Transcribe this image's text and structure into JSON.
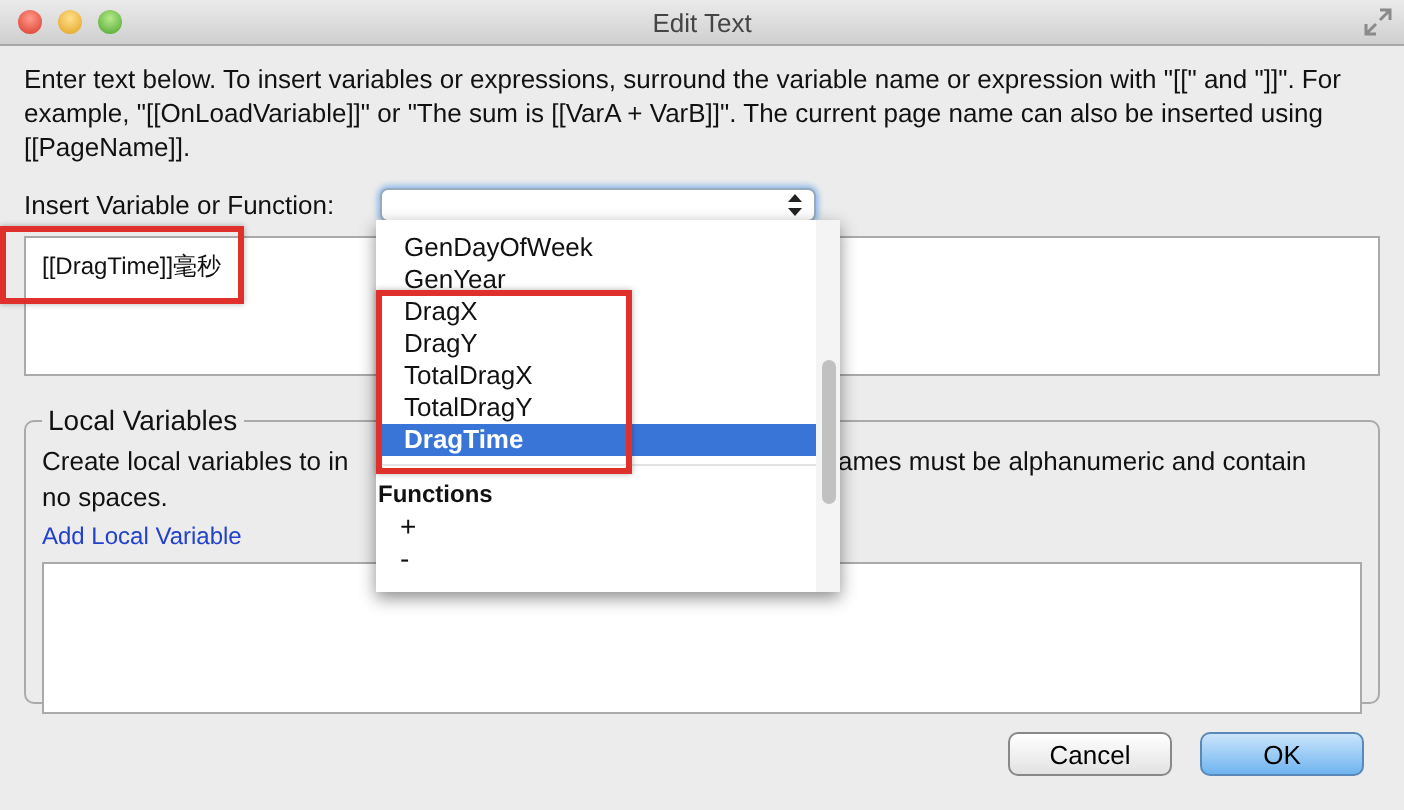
{
  "window": {
    "title": "Edit Text"
  },
  "instructions": "Enter text below. To insert variables or expressions, surround the variable name or expression with \"[[\" and \"]]\". For example, \"[[OnLoadVariable]]\" or \"The sum is [[VarA + VarB]]\". The current page name can also be inserted using [[PageName]].",
  "insert_label": "Insert Variable or Function:",
  "insert_select": {
    "expanded": true
  },
  "text_area": {
    "value": "[[DragTime]]毫秒"
  },
  "dropdown": {
    "items": [
      {
        "kind": "item",
        "label": "GenDayOfWeek",
        "selected": false
      },
      {
        "kind": "item",
        "label": "GenYear",
        "selected": false
      },
      {
        "kind": "item",
        "label": "DragX",
        "selected": false
      },
      {
        "kind": "item",
        "label": "DragY",
        "selected": false
      },
      {
        "kind": "item",
        "label": "TotalDragX",
        "selected": false
      },
      {
        "kind": "item",
        "label": "TotalDragY",
        "selected": false
      },
      {
        "kind": "item",
        "label": "DragTime",
        "selected": true
      },
      {
        "kind": "separator"
      },
      {
        "kind": "header",
        "label": "Functions"
      },
      {
        "kind": "function",
        "label": "+",
        "selected": false
      },
      {
        "kind": "function",
        "label": "-",
        "selected": false
      }
    ]
  },
  "local_variables": {
    "title": "Local Variables",
    "description_start": "Create local variables to in",
    "description_end": "ames must be alphanumeric and contain",
    "description_line_2": "no spaces.",
    "link": "Add Local Variable"
  },
  "buttons": [
    {
      "label": "Cancel",
      "default": false
    },
    {
      "label": "OK",
      "default": true
    }
  ]
}
